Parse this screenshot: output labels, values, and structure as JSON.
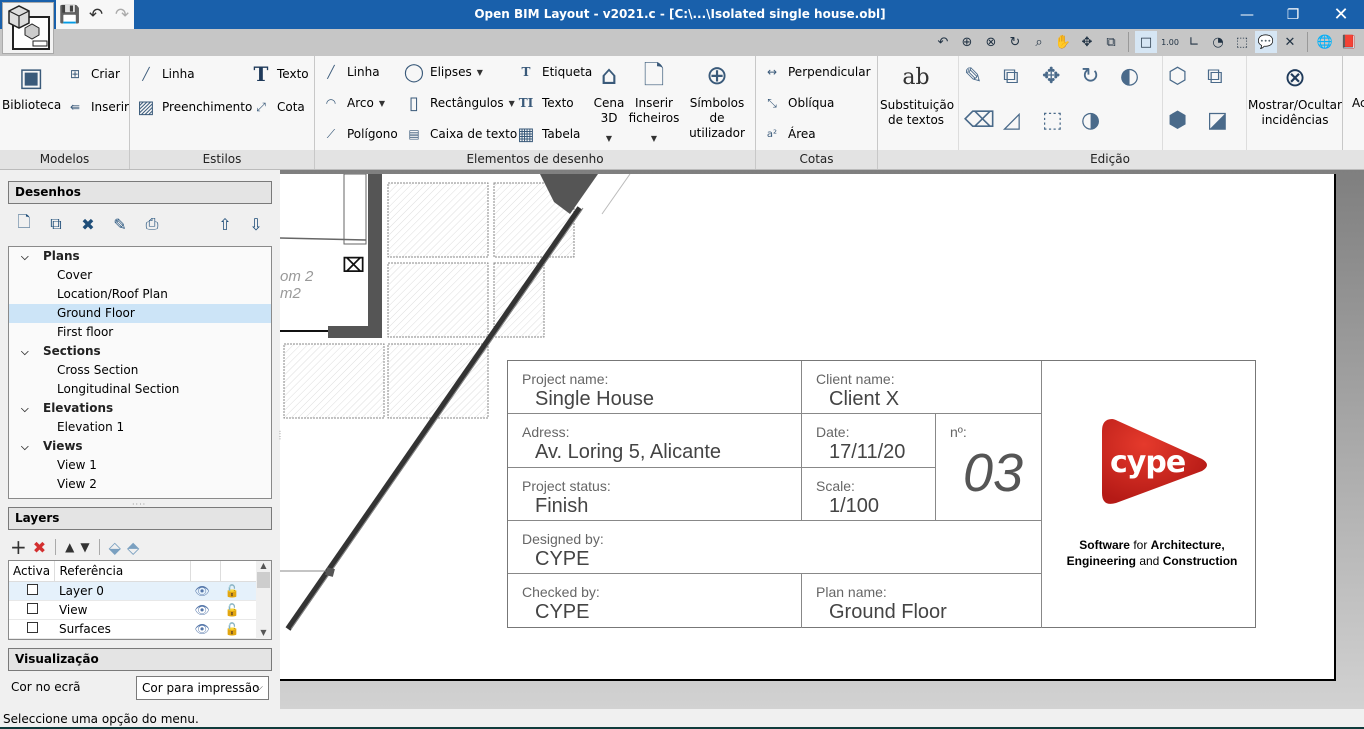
{
  "window": {
    "title": "Open BIM Layout - v2021.c - [C:\\...\\Isolated single house.obl]",
    "minimize_icon": "minimize-icon",
    "restore_icon": "restore-icon",
    "close_icon": "close-icon"
  },
  "quick_access": [
    "save-icon",
    "undo-icon",
    "redo-icon"
  ],
  "view_tools": [
    {
      "name": "zoom-previous-icon",
      "glyph": "↶"
    },
    {
      "name": "zoom-all-icon",
      "glyph": "⊕"
    },
    {
      "name": "zoom-x2-icon",
      "glyph": "⊗"
    },
    {
      "name": "redraw-icon",
      "glyph": "↻"
    },
    {
      "name": "zoom-window-icon",
      "glyph": "⌕"
    },
    {
      "name": "pan-hand-icon",
      "glyph": "✋"
    },
    {
      "name": "orbit-icon",
      "glyph": "✥"
    },
    {
      "name": "window-switch-icon",
      "glyph": "⧉"
    },
    {
      "name": "snap-square-icon",
      "glyph": "□",
      "active": true
    },
    {
      "name": "dimension-icon",
      "glyph": "1.00"
    },
    {
      "name": "angle-icon",
      "glyph": "∟"
    },
    {
      "name": "circle-snap-icon",
      "glyph": "◔"
    },
    {
      "name": "grid-icon",
      "glyph": "⬚"
    },
    {
      "name": "comment-icon",
      "glyph": "💬",
      "active": true
    },
    {
      "name": "tools-icon",
      "glyph": "✕"
    },
    {
      "name": "globe-icon",
      "glyph": "🌐"
    },
    {
      "name": "help-book-icon",
      "glyph": "📕"
    }
  ],
  "ribbon": {
    "groups": {
      "modelos": "Modelos",
      "estilos": "Estilos",
      "elementos": "Elementos de desenho",
      "cotas": "Cotas",
      "edicao": "Edição"
    },
    "modelos": {
      "biblioteca": "Biblioteca",
      "criar": "Criar",
      "inserir": "Inserir"
    },
    "estilos": {
      "linha": "Linha",
      "preenchimento": "Preenchimento",
      "texto": "Texto",
      "cota": "Cota"
    },
    "elementos": {
      "linha": "Linha",
      "arco": "Arco",
      "poligono": "Polígono",
      "elipses": "Elipses",
      "rectangulos": "Rectângulos",
      "caixa_texto": "Caixa de texto",
      "etiqueta": "Etiqueta",
      "texto": "Texto",
      "tabela": "Tabela",
      "cena3d_1": "Cena",
      "cena3d_2": "3D",
      "inserir_1": "Inserir",
      "inserir_2": "ficheiros",
      "simbolos_1": "Símbolos",
      "simbolos_2": "de utilizador"
    },
    "cotas": {
      "perpendicular": "Perpendicular",
      "obliqua": "Oblíqua",
      "area": "Área"
    },
    "edicao": {
      "subst_1": "Substituição",
      "subst_2": "de textos"
    },
    "incidencias": {
      "l1": "Mostrar/Ocultar",
      "l2": "incidências"
    },
    "cut_off": "Ac"
  },
  "desenhos": {
    "header": "Desenhos",
    "tools": [
      "new-drawing-icon",
      "copy-drawing-icon",
      "delete-drawing-icon",
      "edit-drawing-icon",
      "print-icon"
    ],
    "move_up_icon": "arrow-up-icon",
    "move_down_icon": "arrow-down-icon",
    "tree": [
      {
        "label": "Plans",
        "children": [
          "Cover",
          "Location/Roof Plan",
          "Ground Floor",
          "First floor"
        ]
      },
      {
        "label": "Sections",
        "children": [
          "Cross Section",
          "Longitudinal Section"
        ]
      },
      {
        "label": "Elevations",
        "children": [
          "Elevation 1"
        ]
      },
      {
        "label": "Views",
        "children": [
          "View 1",
          "View 2"
        ]
      }
    ],
    "selected": "Ground Floor"
  },
  "layers": {
    "header": "Layers",
    "columns": [
      "Activa",
      "Referência",
      "",
      ""
    ],
    "rows": [
      {
        "active": false,
        "name": "Layer 0",
        "visible": true,
        "locked": false
      },
      {
        "active": false,
        "name": "View",
        "visible": true,
        "locked": false
      },
      {
        "active": false,
        "name": "Surfaces",
        "visible": true,
        "locked": false
      }
    ]
  },
  "visualizacao": {
    "header": "Visualização",
    "label": "Cor no ecrã",
    "selected": "Cor para impressão"
  },
  "drawing": {
    "room_label_1": "om 2",
    "room_label_2": "m2"
  },
  "title_block": {
    "project_name": {
      "label": "Project name:",
      "value": "Single House"
    },
    "client_name": {
      "label": "Client name:",
      "value": "Client X"
    },
    "address": {
      "label": "Adress:",
      "value": "Av. Loring 5, Alicante"
    },
    "date": {
      "label": "Date:",
      "value": "17/11/20"
    },
    "number": {
      "label": "nº:",
      "value": "03"
    },
    "project_status": {
      "label": "Project status:",
      "value": "Finish"
    },
    "scale": {
      "label": "Scale:",
      "value": "1/100"
    },
    "designed_by": {
      "label": "Designed by:",
      "value": "CYPE"
    },
    "checked_by": {
      "label": "Checked by:",
      "value": "CYPE"
    },
    "plan_name": {
      "label": "Plan name:",
      "value": "Ground Floor"
    },
    "logo_text": "cype",
    "tagline_1": [
      "Software",
      " for ",
      "Architecture,"
    ],
    "tagline_2": [
      "Engineering",
      " and ",
      "Construction"
    ],
    "brand_color": "#c8221d"
  },
  "status": "Seleccione uma opção do menu."
}
